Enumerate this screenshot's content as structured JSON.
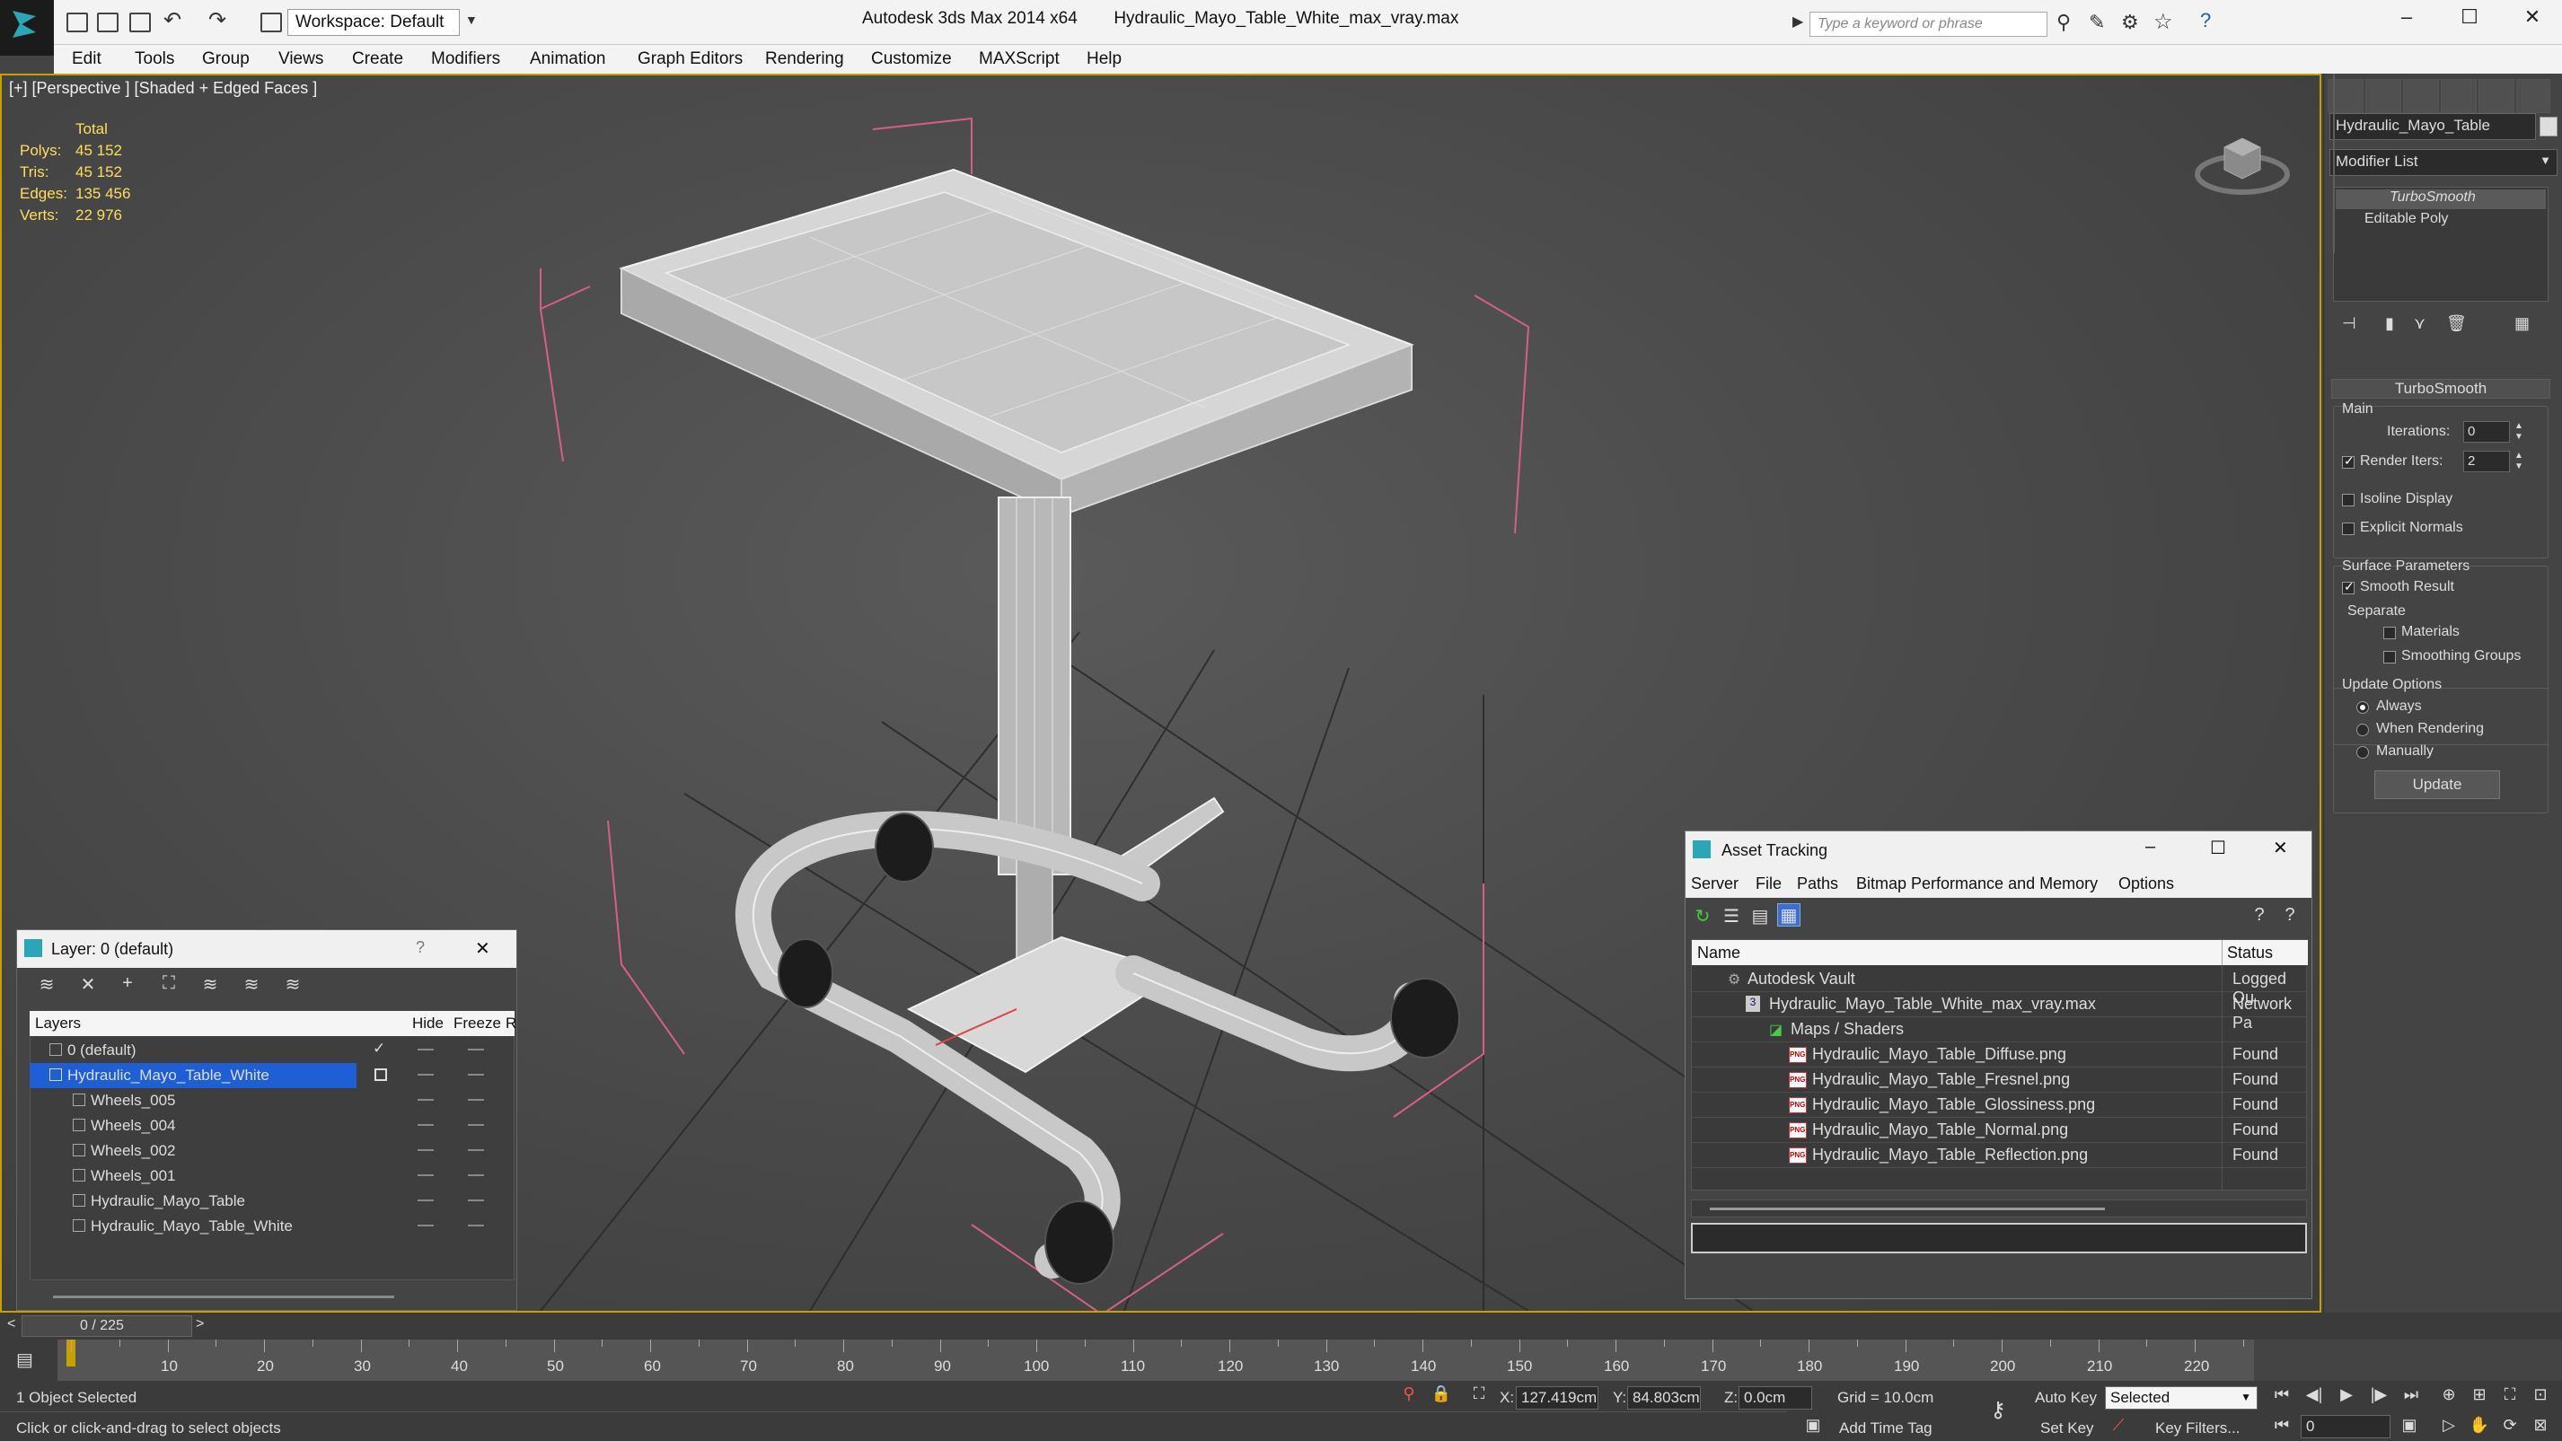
{
  "window": {
    "workspace_label": "Workspace: Default",
    "app_title": "Autodesk 3ds Max  2014 x64",
    "file_title": "Hydraulic_Mayo_Table_White_max_vray.max",
    "search_placeholder": "Type a keyword or phrase"
  },
  "menu": [
    "Edit",
    "Tools",
    "Group",
    "Views",
    "Create",
    "Modifiers",
    "Animation",
    "Graph Editors",
    "Rendering",
    "Customize",
    "MAXScript",
    "Help"
  ],
  "viewport": {
    "label": "[+] [Perspective ] [Shaded + Edged Faces ]",
    "stats_title": "Total",
    "stats": [
      {
        "k": "Polys:",
        "v": "45 152"
      },
      {
        "k": "Tris:",
        "v": "45 152"
      },
      {
        "k": "Edges:",
        "v": "135 456"
      },
      {
        "k": "Verts:",
        "v": "22 976"
      }
    ]
  },
  "command_panel": {
    "object_name": "Hydraulic_Mayo_Table",
    "modifier_list": "Modifier List",
    "stack": [
      "TurboSmooth",
      "Editable Poly"
    ],
    "rollout_title": "TurboSmooth",
    "main_label": "Main",
    "iterations_label": "Iterations:",
    "iterations_value": "0",
    "render_iters_label": "Render Iters:",
    "render_iters_value": "2",
    "isoline_label": "Isoline Display",
    "explicit_normals_label": "Explicit Normals",
    "surface_params_label": "Surface Parameters",
    "smooth_result_label": "Smooth Result",
    "separate_label": "Separate",
    "materials_label": "Materials",
    "smoothing_groups_label": "Smoothing Groups",
    "update_options_label": "Update Options",
    "always_label": "Always",
    "when_rendering_label": "When Rendering",
    "manually_label": "Manually",
    "update_button": "Update"
  },
  "layer_panel": {
    "title": "Layer: 0 (default)",
    "col_layers": "Layers",
    "col_hide": "Hide",
    "col_freeze": "Freeze",
    "col_r": "R",
    "rows": [
      {
        "name": "0 (default)",
        "indent": 0,
        "selected": false,
        "check": true
      },
      {
        "name": "Hydraulic_Mayo_Table_White",
        "indent": 0,
        "selected": true,
        "check": false
      },
      {
        "name": "Wheels_005",
        "indent": 1,
        "selected": false,
        "check": false
      },
      {
        "name": "Wheels_004",
        "indent": 1,
        "selected": false,
        "check": false
      },
      {
        "name": "Wheels_002",
        "indent": 1,
        "selected": false,
        "check": false
      },
      {
        "name": "Wheels_001",
        "indent": 1,
        "selected": false,
        "check": false
      },
      {
        "name": "Hydraulic_Mayo_Table",
        "indent": 1,
        "selected": false,
        "check": false
      },
      {
        "name": "Hydraulic_Mayo_Table_White",
        "indent": 1,
        "selected": false,
        "check": false
      }
    ]
  },
  "asset_panel": {
    "title": "Asset Tracking",
    "menu": [
      "Server",
      "File",
      "Paths",
      "Bitmap Performance and Memory",
      "Options"
    ],
    "col_name": "Name",
    "col_status": "Status",
    "rows": [
      {
        "name": "Autodesk Vault",
        "status": "Logged Ou",
        "indent": 1,
        "icon": "vault"
      },
      {
        "name": "Hydraulic_Mayo_Table_White_max_vray.max",
        "status": "Network Pa",
        "indent": 2,
        "icon": "max"
      },
      {
        "name": "Maps / Shaders",
        "status": "",
        "indent": 3,
        "icon": "maps"
      },
      {
        "name": "Hydraulic_Mayo_Table_Diffuse.png",
        "status": "Found",
        "indent": 4,
        "icon": "png"
      },
      {
        "name": "Hydraulic_Mayo_Table_Fresnel.png",
        "status": "Found",
        "indent": 4,
        "icon": "png"
      },
      {
        "name": "Hydraulic_Mayo_Table_Glossiness.png",
        "status": "Found",
        "indent": 4,
        "icon": "png"
      },
      {
        "name": "Hydraulic_Mayo_Table_Normal.png",
        "status": "Found",
        "indent": 4,
        "icon": "png"
      },
      {
        "name": "Hydraulic_Mayo_Table_Reflection.png",
        "status": "Found",
        "indent": 4,
        "icon": "png"
      }
    ]
  },
  "timeline": {
    "frame_label": "0 / 225",
    "ticks": [
      "10",
      "20",
      "30",
      "40",
      "50",
      "60",
      "70",
      "80",
      "90",
      "100",
      "110",
      "120",
      "130",
      "140",
      "150",
      "160",
      "170",
      "180",
      "190",
      "200",
      "210",
      "220"
    ]
  },
  "status": {
    "selection": "1 Object Selected",
    "prompt": "Click or click-and-drag to select objects",
    "x_label": "X:",
    "x_value": "127.419cm",
    "y_label": "Y:",
    "y_value": "84.803cm",
    "z_label": "Z:",
    "z_value": "0.0cm",
    "grid": "Grid = 10.0cm",
    "add_time_tag": "Add Time Tag",
    "auto_key": "Auto Key",
    "set_key": "Set Key",
    "selected_dropdown": "Selected",
    "key_filters": "Key Filters...",
    "frame_value": "0"
  },
  "colors": {
    "accent": "#c8a000",
    "selection_blue": "#1f5fd6",
    "stats_yellow": "#ffde5a",
    "bbox_pink": "#d85f84"
  }
}
